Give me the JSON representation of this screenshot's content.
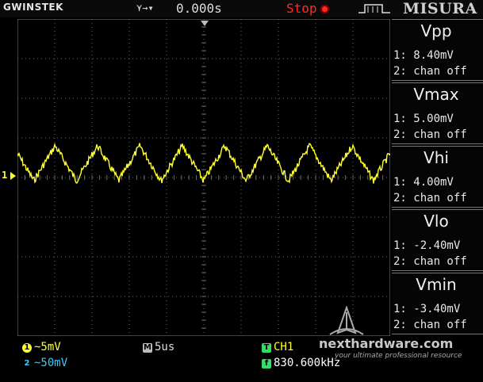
{
  "header": {
    "brand": "GWINSTEK",
    "trigger_icon": "edge-trigger-icon",
    "trigger_time": "0.000s",
    "run_state": "Stop",
    "misura": "MISURA"
  },
  "measurements": [
    {
      "title": "Vpp",
      "ch1": "1: 8.40mV",
      "ch2": "2: chan off"
    },
    {
      "title": "Vmax",
      "ch1": "1: 5.00mV",
      "ch2": "2: chan off"
    },
    {
      "title": "Vhi",
      "ch1": "1: 4.00mV",
      "ch2": "2: chan off"
    },
    {
      "title": "Vlo",
      "ch1": "1: -2.40mV",
      "ch2": "2: chan off"
    },
    {
      "title": "Vmin",
      "ch1": "1: -3.40mV",
      "ch2": "2: chan off"
    }
  ],
  "footer": {
    "ch1_badge": "1",
    "ch1_scale": "~5mV",
    "ch2_badge": "2",
    "ch2_scale": "~50mV",
    "time_badge": "M",
    "timebase": "5us",
    "trig_badge": "T",
    "trig_source": "CH1",
    "freq_badge": "f",
    "frequency": "830.600kHz"
  },
  "screen": {
    "ch1_marker": "1",
    "trace_color": "#ffff33",
    "grid_color": "#6a6a6a"
  },
  "watermark": {
    "text": "nexthardware.com",
    "tagline": "your ultimate professional resource"
  }
}
